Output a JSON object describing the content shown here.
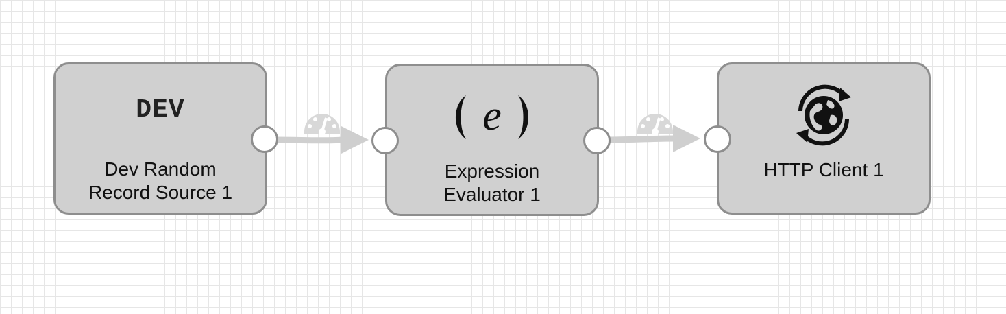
{
  "pipeline": {
    "stages": [
      {
        "id": "dev",
        "icon_text": "DEV",
        "icon": "dev-text-icon",
        "label_lines": [
          "Dev Random",
          "Record Source 1"
        ]
      },
      {
        "id": "expr",
        "icon_text": "(e)",
        "icon": "expression-e-icon",
        "label_lines": [
          "Expression",
          "Evaluator 1"
        ]
      },
      {
        "id": "http",
        "icon": "globe-refresh-icon",
        "label_lines": [
          "HTTP Client 1"
        ]
      }
    ],
    "links": [
      {
        "from": "dev",
        "to": "expr",
        "icon": "gauge-icon"
      },
      {
        "from": "expr",
        "to": "http",
        "icon": "gauge-icon"
      }
    ]
  },
  "colors": {
    "stage_fill": "#d0d0d0",
    "stage_border": "#8e8e8e",
    "port_fill": "#ffffff",
    "link": "#cfcfcf",
    "grid": "#e6e6e6"
  }
}
